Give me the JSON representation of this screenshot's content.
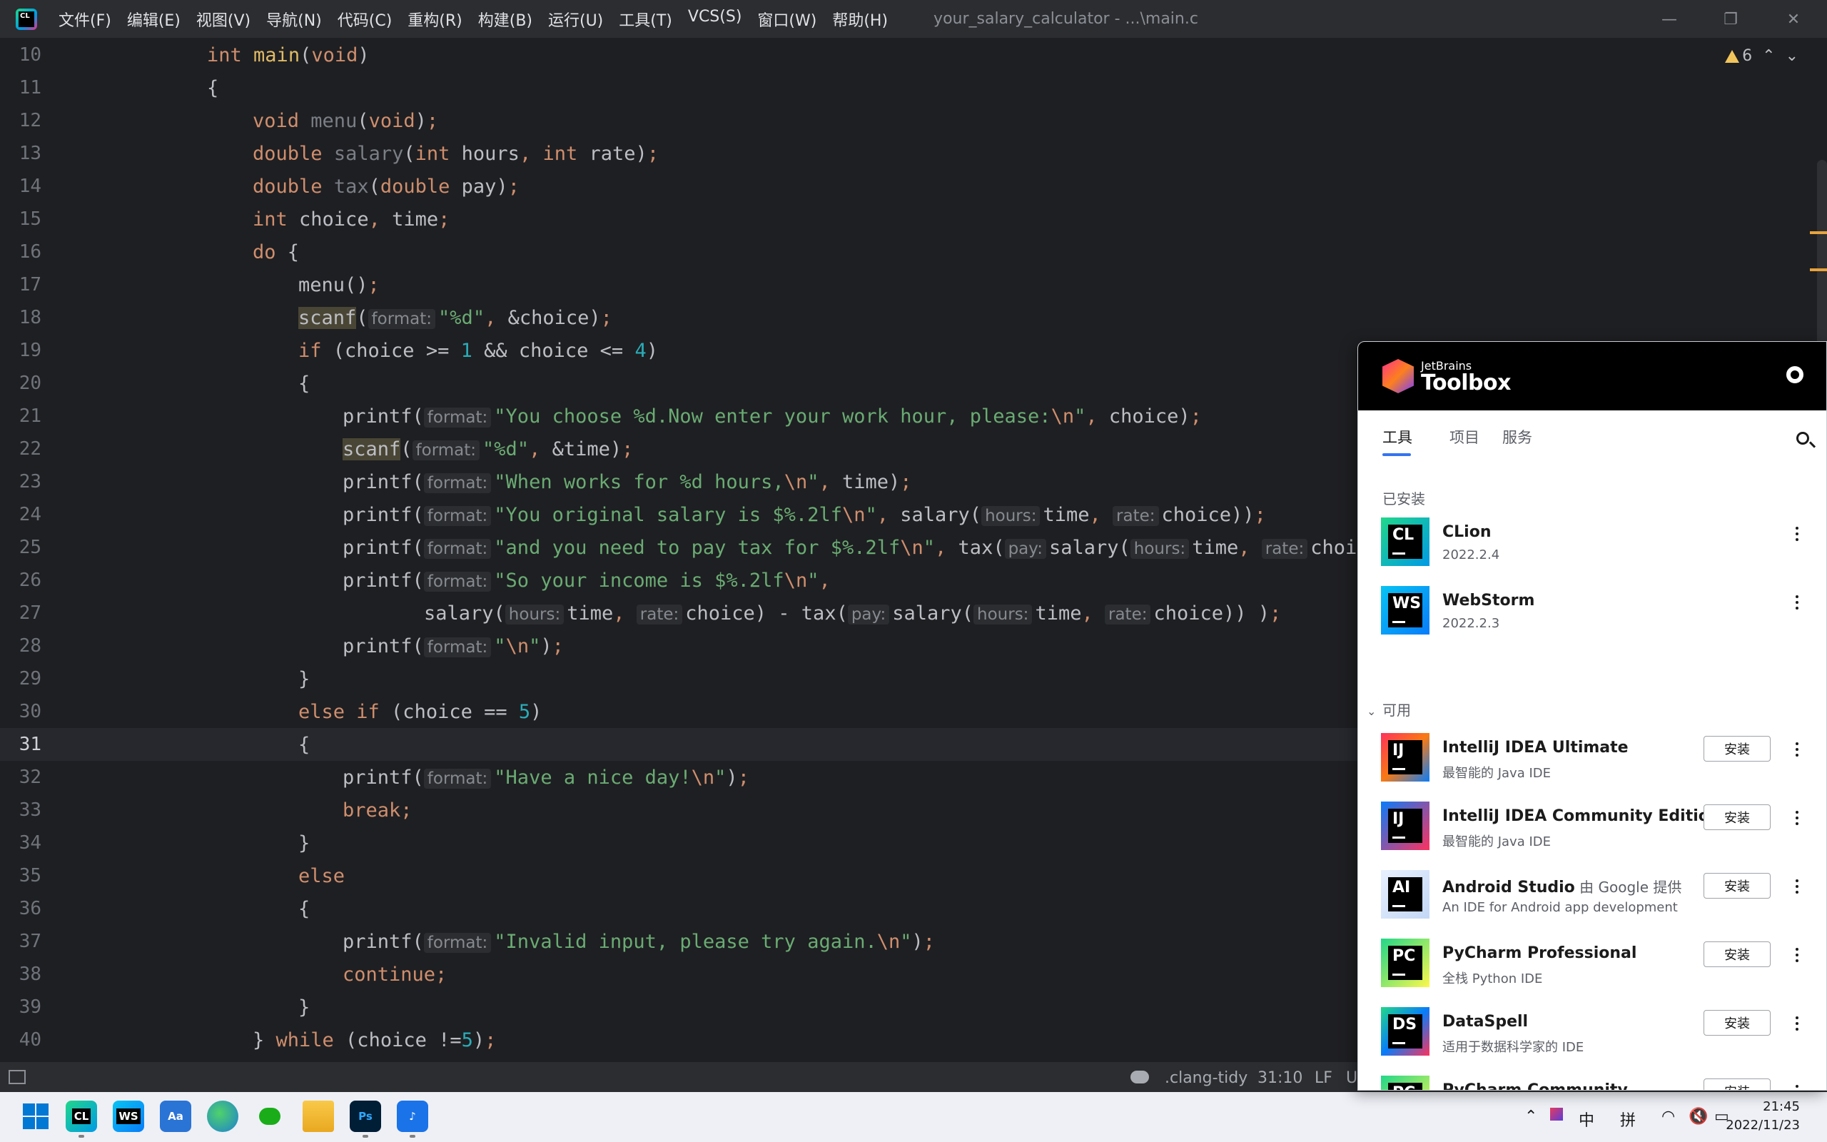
{
  "window": {
    "title": "your_salary_calculator - ...\\main.c",
    "menu": [
      "文件(F)",
      "编辑(E)",
      "视图(V)",
      "导航(N)",
      "代码(C)",
      "重构(R)",
      "构建(B)",
      "运行(U)",
      "工具(T)",
      "VCS(S)",
      "窗口(W)",
      "帮助(H)"
    ],
    "logo_text": "CL",
    "controls": {
      "minimize": "—",
      "restore": "❐",
      "close": "✕"
    }
  },
  "editor": {
    "warnings_count": "6",
    "current_line": 31,
    "line_numbers": [
      "10",
      "11",
      "12",
      "13",
      "14",
      "15",
      "16",
      "17",
      "18",
      "19",
      "20",
      "21",
      "22",
      "23",
      "24",
      "25",
      "26",
      "27",
      "28",
      "29",
      "30",
      "31",
      "32",
      "33",
      "34",
      "35",
      "36",
      "37",
      "38",
      "39",
      "40"
    ]
  },
  "statusbar": {
    "linter": ".clang-tidy",
    "position": "31:10",
    "line_ending": "LF",
    "encoding": "U"
  },
  "toolbox": {
    "brand_small": "JetBrains",
    "brand_big": "Toolbox",
    "tabs": [
      "工具",
      "项目",
      "服务"
    ],
    "installed_label": "已安装",
    "available_label": "可用",
    "install_label": "安装",
    "installed": [
      {
        "name": "CLion",
        "version": "2022.2.4",
        "icon": "CL",
        "grad": "linear-gradient(135deg,#21d789,#009ae5)"
      },
      {
        "name": "WebStorm",
        "version": "2022.2.3",
        "icon": "WS",
        "grad": "linear-gradient(135deg,#07c3f2,#087cfa)"
      }
    ],
    "available": [
      {
        "name": "IntelliJ IDEA Ultimate",
        "sub": "",
        "desc": "最智能的 Java IDE",
        "icon": "IJ",
        "grad": "linear-gradient(135deg,#fe315d,#f97a12,#087cfa)"
      },
      {
        "name": "IntelliJ IDEA Community Edition",
        "sub": "",
        "desc": "最智能的 Java IDE",
        "icon": "IJ",
        "grad": "linear-gradient(135deg,#087cfa,#fe315d)"
      },
      {
        "name": "Android Studio",
        "sub": " 由 Google 提供",
        "desc": "An IDE for Android app development",
        "icon": "AI",
        "grad": "linear-gradient(135deg,#e8f0fe,#c3d7f5)"
      },
      {
        "name": "PyCharm Professional",
        "sub": "",
        "desc": "全栈 Python IDE",
        "icon": "PC",
        "grad": "linear-gradient(135deg,#21d789,#fcf84a)"
      },
      {
        "name": "DataSpell",
        "sub": "",
        "desc": "适用于数据科学家的 IDE",
        "icon": "DS",
        "grad": "linear-gradient(135deg,#21d789,#087cfa,#fe315d)"
      },
      {
        "name": "PyCharm Community",
        "sub": "",
        "desc": "",
        "icon": "PC",
        "grad": "linear-gradient(135deg,#21d789,#fcf84a)"
      }
    ]
  },
  "taskbar": {
    "tray": {
      "ime_zh": "中",
      "ime_pinyin": "拼"
    },
    "clock_time": "21:45",
    "clock_date": "2022/11/23"
  }
}
